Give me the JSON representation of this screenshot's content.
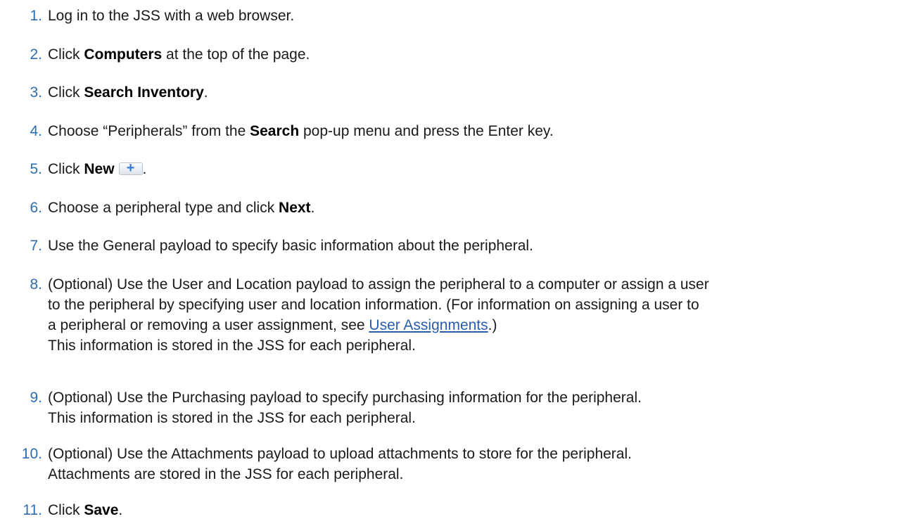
{
  "steps": [
    {
      "num": "1.",
      "pre": "Log in to the JSS with a web browser."
    },
    {
      "num": "2.",
      "pre": "Click ",
      "bold": "Computers",
      "post": " at the top of the page."
    },
    {
      "num": "3.",
      "pre": "Click ",
      "bold": "Search Inventory",
      "post": "."
    },
    {
      "num": "4.",
      "pre": "Choose “Peripherals” from the ",
      "bold": "Search",
      "post": " pop-up menu and press the Enter key."
    },
    {
      "num": "5.",
      "pre": "Click ",
      "bold": "New",
      "icon": "plus-icon",
      "post": "."
    },
    {
      "num": "6.",
      "pre": "Choose a peripheral type and click ",
      "bold": "Next",
      "post": "."
    },
    {
      "num": "7.",
      "pre": "Use the General payload to specify basic information about the peripheral."
    },
    {
      "num": "8.",
      "line1": "(Optional) Use the User and Location payload to assign the peripheral to a computer or assign a user",
      "line2": "to the peripheral by specifying user and location information. (For information on assigning a user to",
      "line3_pre": "a peripheral or removing a user assignment, see ",
      "link": "User Assignments",
      "line3_post": ".)",
      "line4": "This information is stored in the JSS for each peripheral."
    },
    {
      "num": "9.",
      "line1": "(Optional) Use the Purchasing payload to specify purchasing information for the peripheral.",
      "line2": "This information is stored in the JSS for each peripheral."
    },
    {
      "num": "10.",
      "line1": "(Optional) Use the Attachments payload to upload attachments to store for the peripheral.",
      "line2": "Attachments are stored in the JSS for each peripheral."
    },
    {
      "num": "11.",
      "pre": "Click ",
      "bold": "Save",
      "post": "."
    }
  ],
  "colors": {
    "number": "#2f6db0",
    "link": "#2a5db0",
    "text": "#1a1a1a"
  }
}
